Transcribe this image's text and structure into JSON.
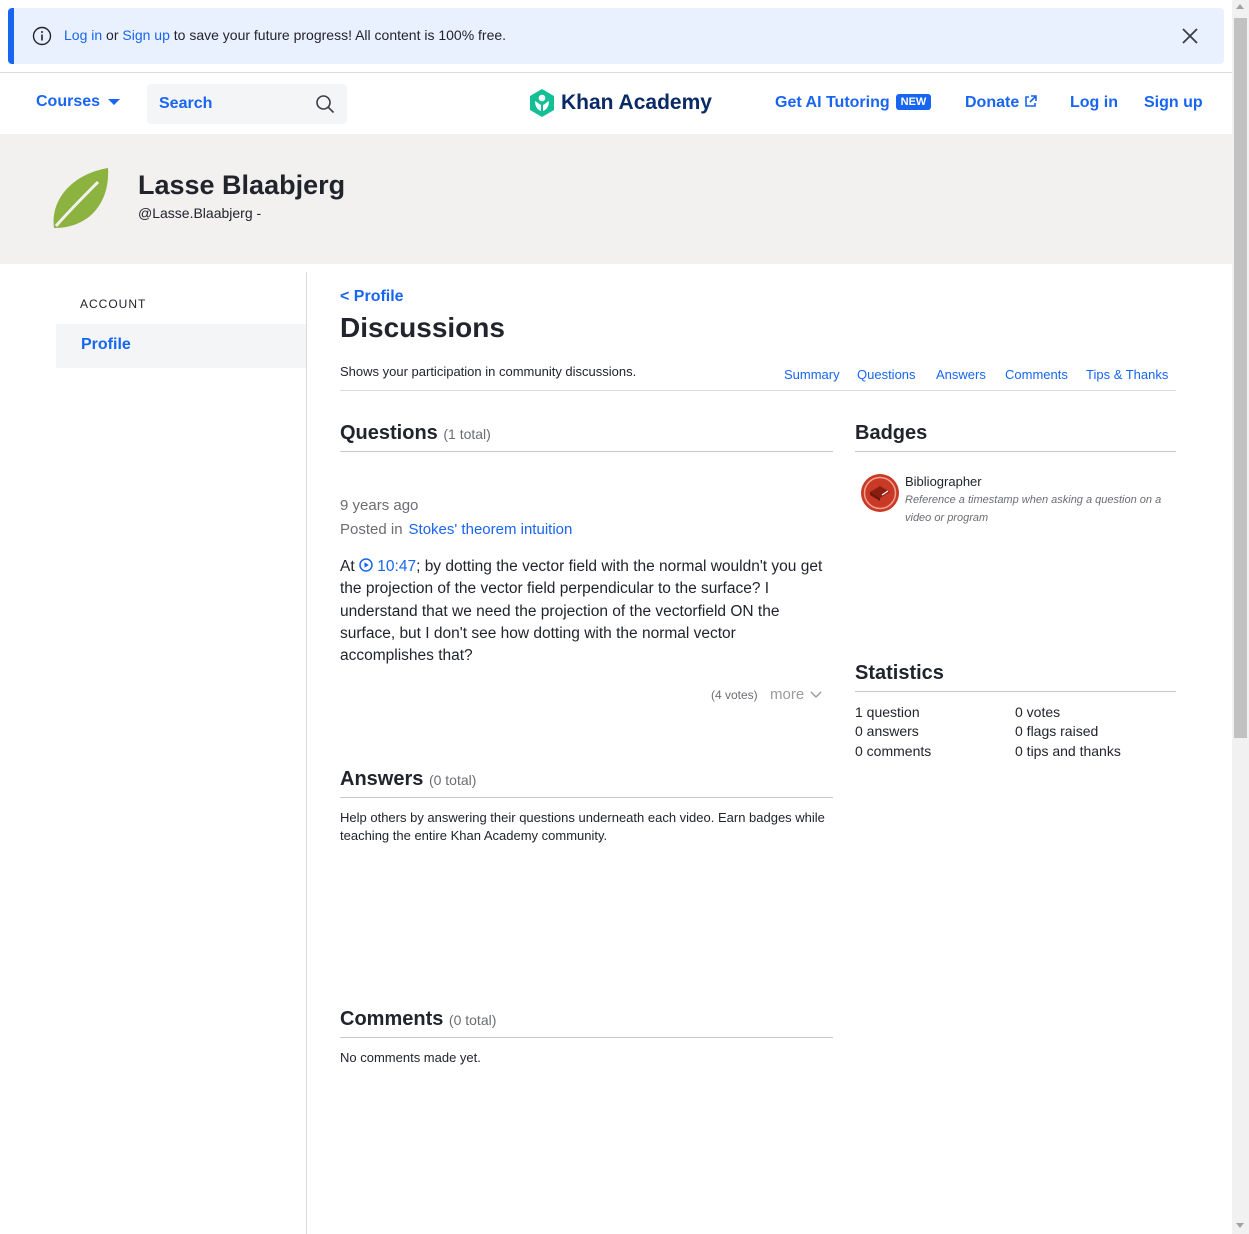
{
  "banner": {
    "login_link": "Log in",
    "or_text": "or",
    "signup_link": "Sign up",
    "message": "to save your future progress! All content is 100% free."
  },
  "header": {
    "courses_label": "Courses",
    "search_placeholder": "Search",
    "logo_text": "Khan Academy",
    "ai_tutoring_label": "Get AI Tutoring",
    "new_badge": "NEW",
    "donate_label": "Donate",
    "login_label": "Log in",
    "signup_label": "Sign up"
  },
  "profile": {
    "name": "Lasse Blaabjerg",
    "handle": "@Lasse.Blaabjerg -"
  },
  "sidebar": {
    "section_label": "ACCOUNT",
    "items": [
      {
        "label": "Profile"
      }
    ]
  },
  "main": {
    "back_link": "< Profile",
    "title": "Discussions",
    "subtitle": "Shows your participation in community discussions.",
    "tabs": [
      "Summary",
      "Questions",
      "Answers",
      "Comments",
      "Tips & Thanks"
    ]
  },
  "questions": {
    "title": "Questions",
    "count": "(1 total)",
    "items": [
      {
        "time": "9 years ago",
        "posted_in_label": "Posted in",
        "posted_in_link": "Stokes' theorem intuition",
        "prefix": "At",
        "timestamp": "10:47",
        "body": "; by dotting the vector field with the normal wouldn't you get the projection of the vector field perpendicular to the surface? I understand that we need the projection of the vectorfield ON the surface, but I don't see how dotting with the normal vector accomplishes that?",
        "votes": "(4 votes)",
        "more_label": "more"
      }
    ]
  },
  "answers": {
    "title": "Answers",
    "count": "(0 total)",
    "message": "Help others by answering their questions underneath each video. Earn badges while teaching the entire Khan Academy community."
  },
  "comments": {
    "title": "Comments",
    "count": "(0 total)",
    "message": "No comments made yet."
  },
  "badges": {
    "title": "Badges",
    "items": [
      {
        "name": "Bibliographer",
        "description": "Reference a timestamp when asking a question on a video or program"
      }
    ]
  },
  "statistics": {
    "title": "Statistics",
    "left": [
      "1 question",
      "0 answers",
      "0 comments"
    ],
    "right": [
      "0 votes",
      "0 flags raised",
      "0 tips and thanks"
    ]
  },
  "colors": {
    "accent": "#1865f2",
    "banner_bg": "#eaf1fe",
    "profile_band": "#f2f1ef",
    "logo_green": "#14bf96",
    "avatar_green": "#8cb33f",
    "badge_red": "#c83a26"
  },
  "icons": [
    "info-icon",
    "close-icon",
    "chevron-down-icon",
    "search-icon",
    "khan-logo-icon",
    "external-link-icon",
    "leaf-avatar-icon",
    "play-icon",
    "badge-icon"
  ]
}
